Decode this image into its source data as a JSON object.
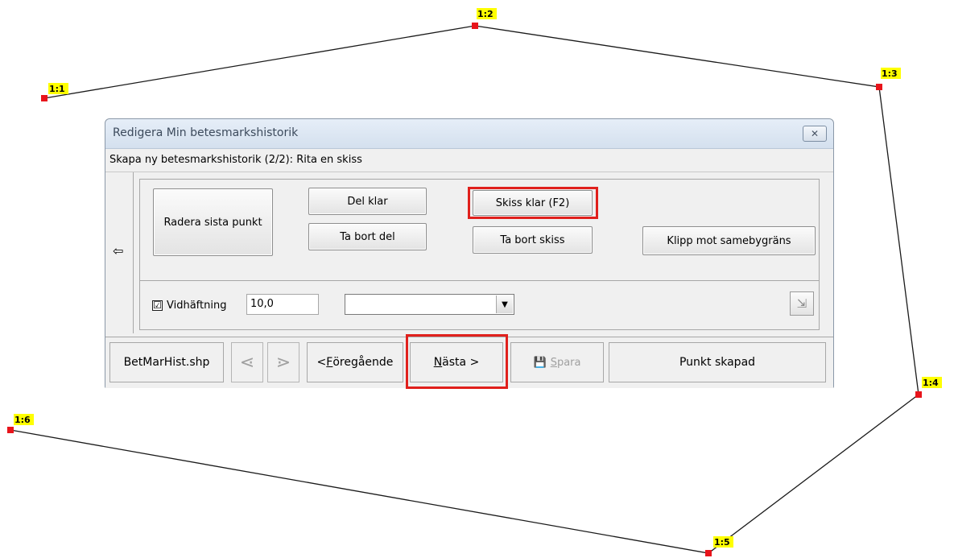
{
  "vertices": [
    {
      "label": "1:1"
    },
    {
      "label": "1:2"
    },
    {
      "label": "1:3"
    },
    {
      "label": "1:4"
    },
    {
      "label": "1:5"
    },
    {
      "label": "1:6"
    }
  ],
  "colors": {
    "vertex": "#e8141b",
    "label_bg": "#ffff00",
    "highlight": "#e0201c"
  },
  "dialog": {
    "title": "Redigera Min betesmarkshistorik",
    "close_icon": "close-icon",
    "step_text": "Skapa ny betesmarkshistorik (2/2): Rita en skiss",
    "back_icon": "arrow-left-icon",
    "buttons": {
      "delete_last_point": "Radera sista punkt",
      "part_done": "Del klar",
      "remove_part": "Ta bort del",
      "sketch_done": "Skiss klar (F2)",
      "remove_sketch": "Ta bort skiss",
      "clip_boundary": "Klipp mot samebygräns"
    },
    "snapping": {
      "checked": true,
      "check_mark": "☑",
      "label": "Vidhäftning",
      "value": "10,0"
    },
    "combo": {
      "value": "",
      "arrow_icon": "chevron-down-icon"
    },
    "tool_icon": "export-icon",
    "footer": {
      "layer_name": "BetMarHist.shp",
      "prev_arrow_icon": "arrow-back-icon",
      "next_arrow_icon": "arrow-forward-icon",
      "previous_prefix": "< ",
      "previous_underlined": "F",
      "previous_rest": "öregående",
      "next_underlined": "N",
      "next_rest": "ästa >",
      "save_icon": "floppy-icon",
      "save_underlined": "S",
      "save_rest": "para",
      "status": "Punkt skapad"
    }
  }
}
